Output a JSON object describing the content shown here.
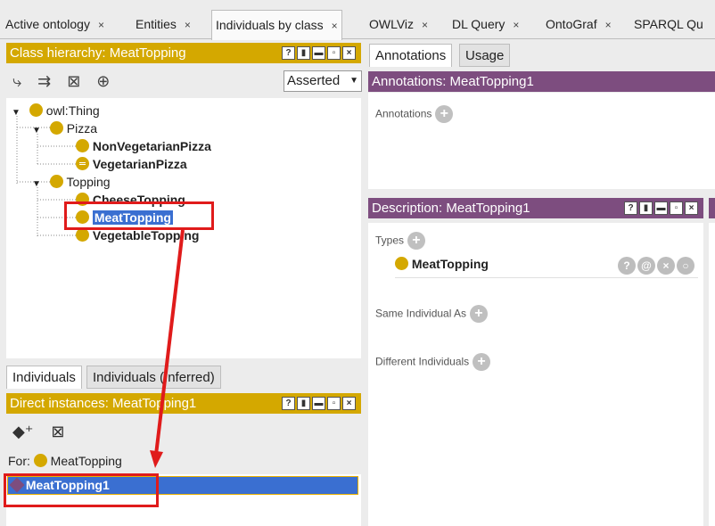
{
  "tabs": [
    {
      "label": "Active ontology",
      "x": "×"
    },
    {
      "label": "Entities",
      "x": "×"
    },
    {
      "label": "Individuals by class",
      "x": "×"
    },
    {
      "label": "OWLViz",
      "x": "×"
    },
    {
      "label": "DL Query",
      "x": "×"
    },
    {
      "label": "OntoGraf",
      "x": "×"
    },
    {
      "label": "SPARQL Qu"
    }
  ],
  "class_hierarchy": {
    "title": "Class hierarchy: MeatTopping",
    "mode": "Asserted",
    "tree": {
      "root": "owl:Thing",
      "pizza": "Pizza",
      "nonveg": "NonVegetarianPizza",
      "veg": "VegetarianPizza",
      "topping": "Topping",
      "cheese": "CheeseTopping",
      "meat": "MeatTopping",
      "vegetable": "VegetableTopping"
    }
  },
  "individuals_tabs": [
    "Individuals",
    "Individuals (Inferred)"
  ],
  "direct_instances": {
    "title": "Direct instances: MeatTopping1",
    "for_label": "For:",
    "for_class": "MeatTopping",
    "items": [
      "MeatTopping1"
    ]
  },
  "annot_tabs": [
    "Annotations",
    "Usage"
  ],
  "annotations": {
    "title": "Annotations: MeatTopping1",
    "label": "Annotations"
  },
  "description": {
    "title": "Description: MeatTopping1",
    "types_label": "Types",
    "type_value": "MeatTopping",
    "same_label": "Same Individual As",
    "different_label": "Different Individuals"
  },
  "colors": {
    "class": "#d4a800",
    "annotation_header": "#7d4d7f",
    "selection": "#3a6fd1",
    "highlight": "#e01b1b"
  }
}
